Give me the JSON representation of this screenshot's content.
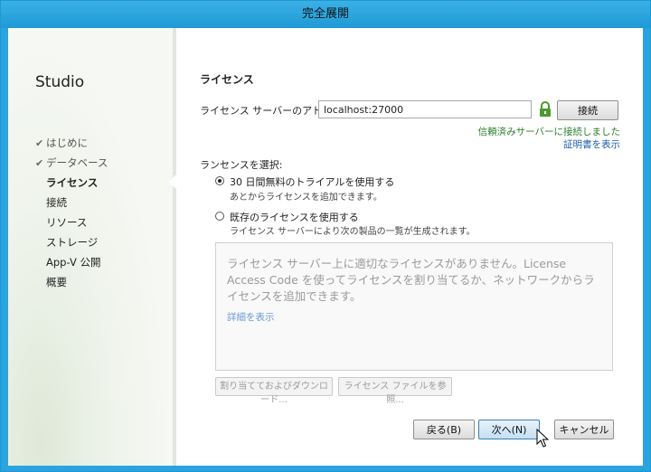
{
  "window": {
    "title": "完全展開"
  },
  "sidebar": {
    "brand": "Studio",
    "steps": [
      {
        "label": "はじめに",
        "state": "done"
      },
      {
        "label": "データベース",
        "state": "done"
      },
      {
        "label": "ライセンス",
        "state": "current"
      },
      {
        "label": "接続",
        "state": "pending"
      },
      {
        "label": "リソース",
        "state": "pending"
      },
      {
        "label": "ストレージ",
        "state": "pending"
      },
      {
        "label": "App-V 公開",
        "state": "pending"
      },
      {
        "label": "概要",
        "state": "pending"
      }
    ]
  },
  "license": {
    "section_title": "ライセンス",
    "server_address_label": "ライセンス サーバーのアドレス:",
    "server_address_value": "localhost:27000",
    "connect_button": "接続",
    "status_connected": "信頼済みサーバーに接続しました",
    "view_certificate_link": "証明書を表示",
    "select_label": "ランセンスを選択:",
    "options": [
      {
        "title": "30 日間無料のトライアルを使用する",
        "subtitle": "あとからライセンスを追加できます。",
        "selected": true
      },
      {
        "title": "既存のライセンスを使用する",
        "subtitle": "ライセンス サーバーにより次の製品の一覧が生成されます。",
        "selected": false
      }
    ],
    "info_message": "ライセンス サーバー上に適切なライセンスがありません。License Access Code を使ってライセンスを割り当てるか、ネットワークからライセンスを追加できます。",
    "details_link": "詳細を表示",
    "assign_download_button": "割り当てておよびダウンロード...",
    "browse_license_file_button": "ライセンス ファイルを参照..."
  },
  "footer": {
    "back_button": "戻る(B)",
    "next_button": "次へ(N)",
    "cancel_button": "キャンセル"
  },
  "colors": {
    "title_bar": "#2aa4de",
    "status_ok": "#2a7d2a",
    "link": "#1f5fa8",
    "lock_icon": "#4c9a2a"
  }
}
